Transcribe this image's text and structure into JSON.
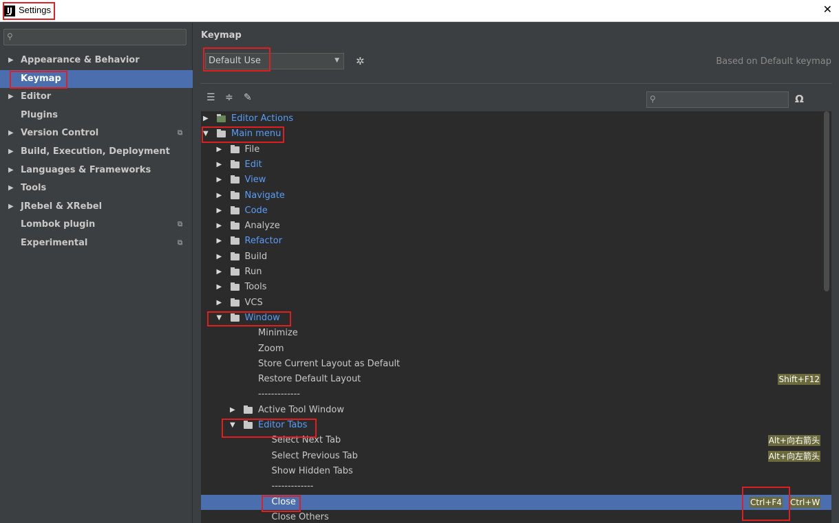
{
  "window": {
    "title": "Settings",
    "app_icon": "IJ",
    "close_glyph": "✕"
  },
  "sidebar": {
    "items": [
      {
        "label": "Appearance & Behavior",
        "expandable": true,
        "project": false
      },
      {
        "label": "Keymap",
        "expandable": false,
        "project": false,
        "selected": true
      },
      {
        "label": "Editor",
        "expandable": true,
        "project": false
      },
      {
        "label": "Plugins",
        "expandable": false,
        "project": false
      },
      {
        "label": "Version Control",
        "expandable": true,
        "project": true
      },
      {
        "label": "Build, Execution, Deployment",
        "expandable": true,
        "project": false
      },
      {
        "label": "Languages & Frameworks",
        "expandable": true,
        "project": false
      },
      {
        "label": "Tools",
        "expandable": true,
        "project": false
      },
      {
        "label": "JRebel & XRebel",
        "expandable": true,
        "project": false
      },
      {
        "label": "Lombok plugin",
        "expandable": false,
        "project": true
      },
      {
        "label": "Experimental",
        "expandable": false,
        "project": true
      }
    ]
  },
  "main": {
    "title": "Keymap",
    "keymap_select": {
      "value": "Default Use"
    },
    "based_on": "Based on Default keymap",
    "tree": [
      {
        "level": 0,
        "arrow": "right",
        "icon": "editor-actions",
        "label": "Editor Actions",
        "style": "blue"
      },
      {
        "level": 0,
        "arrow": "down",
        "icon": "menu-folder",
        "label": "Main menu",
        "style": "blue"
      },
      {
        "level": 1,
        "arrow": "right",
        "icon": "folder",
        "label": "File",
        "style": "plain"
      },
      {
        "level": 1,
        "arrow": "right",
        "icon": "folder",
        "label": "Edit",
        "style": "blue"
      },
      {
        "level": 1,
        "arrow": "right",
        "icon": "folder",
        "label": "View",
        "style": "blue"
      },
      {
        "level": 1,
        "arrow": "right",
        "icon": "folder",
        "label": "Navigate",
        "style": "blue"
      },
      {
        "level": 1,
        "arrow": "right",
        "icon": "folder",
        "label": "Code",
        "style": "blue"
      },
      {
        "level": 1,
        "arrow": "right",
        "icon": "folder",
        "label": "Analyze",
        "style": "plain"
      },
      {
        "level": 1,
        "arrow": "right",
        "icon": "folder",
        "label": "Refactor",
        "style": "blue"
      },
      {
        "level": 1,
        "arrow": "right",
        "icon": "folder",
        "label": "Build",
        "style": "plain"
      },
      {
        "level": 1,
        "arrow": "right",
        "icon": "folder",
        "label": "Run",
        "style": "plain"
      },
      {
        "level": 1,
        "arrow": "right",
        "icon": "folder",
        "label": "Tools",
        "style": "plain"
      },
      {
        "level": 1,
        "arrow": "right",
        "icon": "folder",
        "label": "VCS",
        "style": "plain"
      },
      {
        "level": 1,
        "arrow": "down",
        "icon": "folder",
        "label": "Window",
        "style": "blue"
      },
      {
        "level": 2,
        "arrow": "",
        "icon": "",
        "label": "Minimize",
        "style": "plain"
      },
      {
        "level": 2,
        "arrow": "",
        "icon": "",
        "label": "Zoom",
        "style": "plain"
      },
      {
        "level": 2,
        "arrow": "",
        "icon": "",
        "label": "Store Current Layout as Default",
        "style": "plain"
      },
      {
        "level": 2,
        "arrow": "",
        "icon": "",
        "label": "Restore Default Layout",
        "style": "plain",
        "shortcuts": [
          "Shift+F12"
        ]
      },
      {
        "level": 2,
        "arrow": "",
        "icon": "",
        "label": "-------------",
        "style": "plain"
      },
      {
        "level": 2,
        "arrow": "right",
        "icon": "folder",
        "label": "Active Tool Window",
        "style": "plain"
      },
      {
        "level": 2,
        "arrow": "down",
        "icon": "folder",
        "label": "Editor Tabs",
        "style": "blue"
      },
      {
        "level": 3,
        "arrow": "",
        "icon": "",
        "label": "Select Next Tab",
        "style": "plain",
        "shortcuts": [
          "Alt+向右箭头"
        ]
      },
      {
        "level": 3,
        "arrow": "",
        "icon": "",
        "label": "Select Previous Tab",
        "style": "plain",
        "shortcuts": [
          "Alt+向左箭头"
        ]
      },
      {
        "level": 3,
        "arrow": "",
        "icon": "",
        "label": "Show Hidden Tabs",
        "style": "plain"
      },
      {
        "level": 3,
        "arrow": "",
        "icon": "",
        "label": "-------------",
        "style": "plain"
      },
      {
        "level": 3,
        "arrow": "",
        "icon": "",
        "label": "Close",
        "style": "plain",
        "selected": true,
        "shortcuts": [
          "Ctrl+F4",
          "Ctrl+W"
        ]
      },
      {
        "level": 3,
        "arrow": "",
        "icon": "",
        "label": "Close Others",
        "style": "plain"
      }
    ]
  },
  "colors": {
    "selection": "#4b6eaf",
    "link_blue": "#589df6",
    "highlight_box": "#e02020",
    "shortcut_bg": "#6b6a3c"
  }
}
